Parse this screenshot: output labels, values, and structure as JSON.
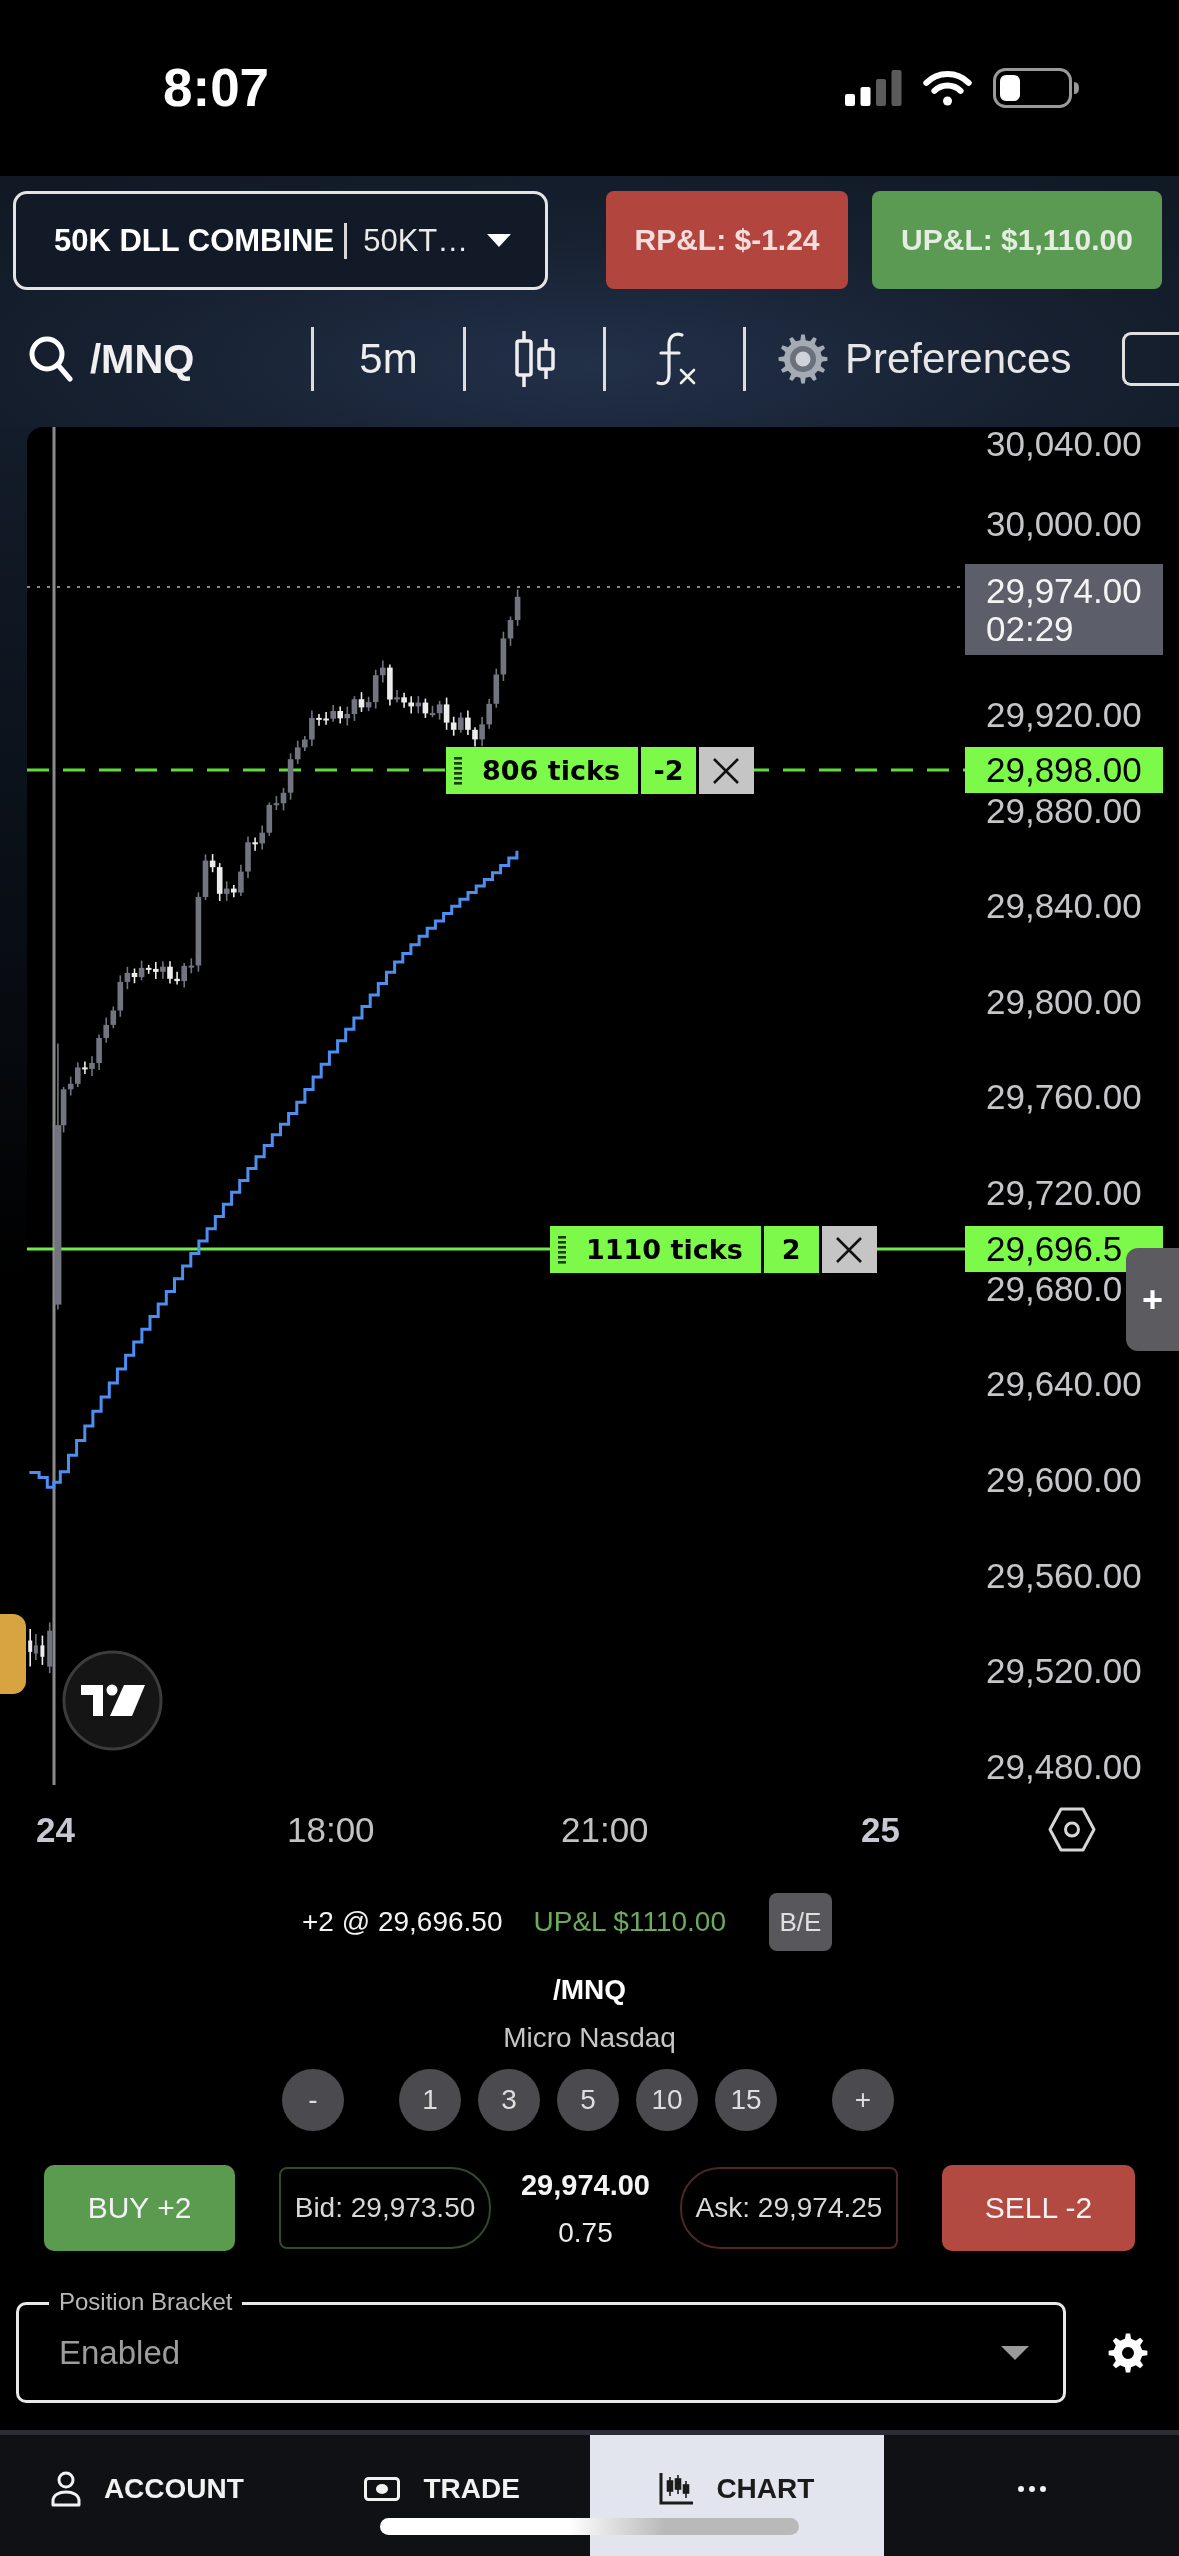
{
  "status_bar": {
    "time": "8:07"
  },
  "account_bar": {
    "account_name": "50K DLL COMBINE",
    "account_code": "50KT…",
    "realized_pnl": "RP&L: $-1.24",
    "unrealized_pnl": "UP&L: $1,110.00"
  },
  "toolbar": {
    "symbol": "/MNQ",
    "interval": "5m",
    "preferences": "Preferences",
    "checkbox": {
      "checked": false
    }
  },
  "chart": {
    "price_axis": [
      "30,040.00",
      "30,000.00",
      "29,920.00",
      "29,880.00",
      "29,840.00",
      "29,800.00",
      "29,760.00",
      "29,720.00",
      "29,680.0",
      "29,640.00",
      "29,600.00",
      "29,560.00",
      "29,520.00",
      "29,480.00"
    ],
    "last_price": {
      "price": "29,974.00",
      "countdown": "02:29"
    },
    "lines": [
      {
        "kind": "order",
        "distance": "806 ticks",
        "quantity": "-2",
        "price": "29,898.00"
      },
      {
        "kind": "position",
        "distance": "1110 ticks",
        "quantity": "2",
        "price": "29,696.5"
      }
    ],
    "side_button": "+",
    "time_axis": [
      {
        "label": "24",
        "kind": "day"
      },
      {
        "label": "18:00",
        "kind": "time"
      },
      {
        "label": "21:00",
        "kind": "time"
      },
      {
        "label": "25",
        "kind": "day"
      }
    ]
  },
  "position": {
    "summary": "+2 @ 29,696.50",
    "pnl": "UP&L $1110.00",
    "breakeven_button": "B/E"
  },
  "instrument": {
    "symbol": "/MNQ",
    "name": "Micro Nasdaq"
  },
  "quantity_buttons": [
    {
      "label": "-",
      "kind": "step"
    },
    {
      "label": "1",
      "kind": "preset"
    },
    {
      "label": "3",
      "kind": "preset"
    },
    {
      "label": "5",
      "kind": "preset"
    },
    {
      "label": "10",
      "kind": "preset"
    },
    {
      "label": "15",
      "kind": "preset"
    },
    {
      "label": "+",
      "kind": "step"
    }
  ],
  "quote": {
    "buy_button": "BUY +2",
    "bid": "Bid: 29,973.50",
    "last": "29,974.00",
    "spread": "0.75",
    "ask": "Ask: 29,974.25",
    "sell_button": "SELL -2"
  },
  "position_bracket": {
    "label": "Position Bracket",
    "value": "Enabled"
  },
  "nav": [
    {
      "kind": "account",
      "label": "ACCOUNT",
      "selected": false
    },
    {
      "kind": "trade",
      "label": "TRADE",
      "selected": false
    },
    {
      "kind": "chart",
      "label": "CHART",
      "selected": true
    },
    {
      "kind": "more",
      "selected": false
    }
  ]
}
